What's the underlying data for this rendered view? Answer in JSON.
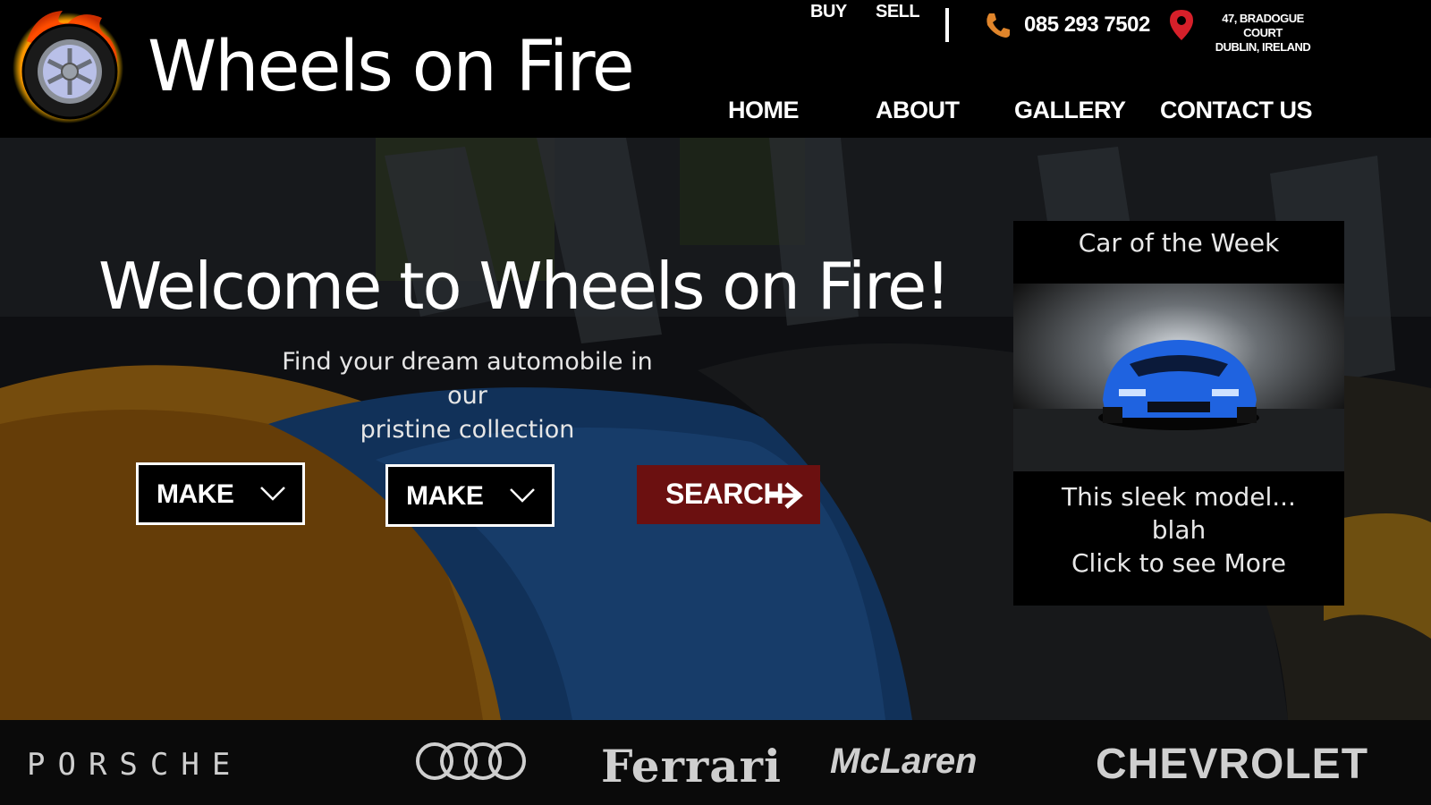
{
  "brand": {
    "title": "Wheels on Fire"
  },
  "top_links": [
    "BUY",
    "SELL"
  ],
  "contact": {
    "phone": "085 293 7502",
    "address_line1": "47, BRADOGUE COURT",
    "address_line2": "DUBLIN, IRELAND"
  },
  "nav": [
    "HOME",
    "ABOUT",
    "GALLERY",
    "CONTACT US"
  ],
  "hero": {
    "heading": "Welcome to Wheels on Fire!",
    "tagline_line1": "Find your dream automobile in our",
    "tagline_line2": "pristine collection",
    "dropdown1": "MAKE",
    "dropdown2": "MAKE",
    "search_label": "SEARCH"
  },
  "car_of_week": {
    "title": "Car of the Week",
    "line1": "This sleek model...",
    "line2": "blah",
    "link": "Click to see More"
  },
  "brands": {
    "porsche": "PORSCHE",
    "ferrari": "Ferrari",
    "mclaren": "McLaren",
    "chevrolet": "CHEVROLET"
  },
  "colors": {
    "accent_red": "#6b1010",
    "phone_icon": "#e0852b",
    "pin_icon": "#d6202a"
  }
}
